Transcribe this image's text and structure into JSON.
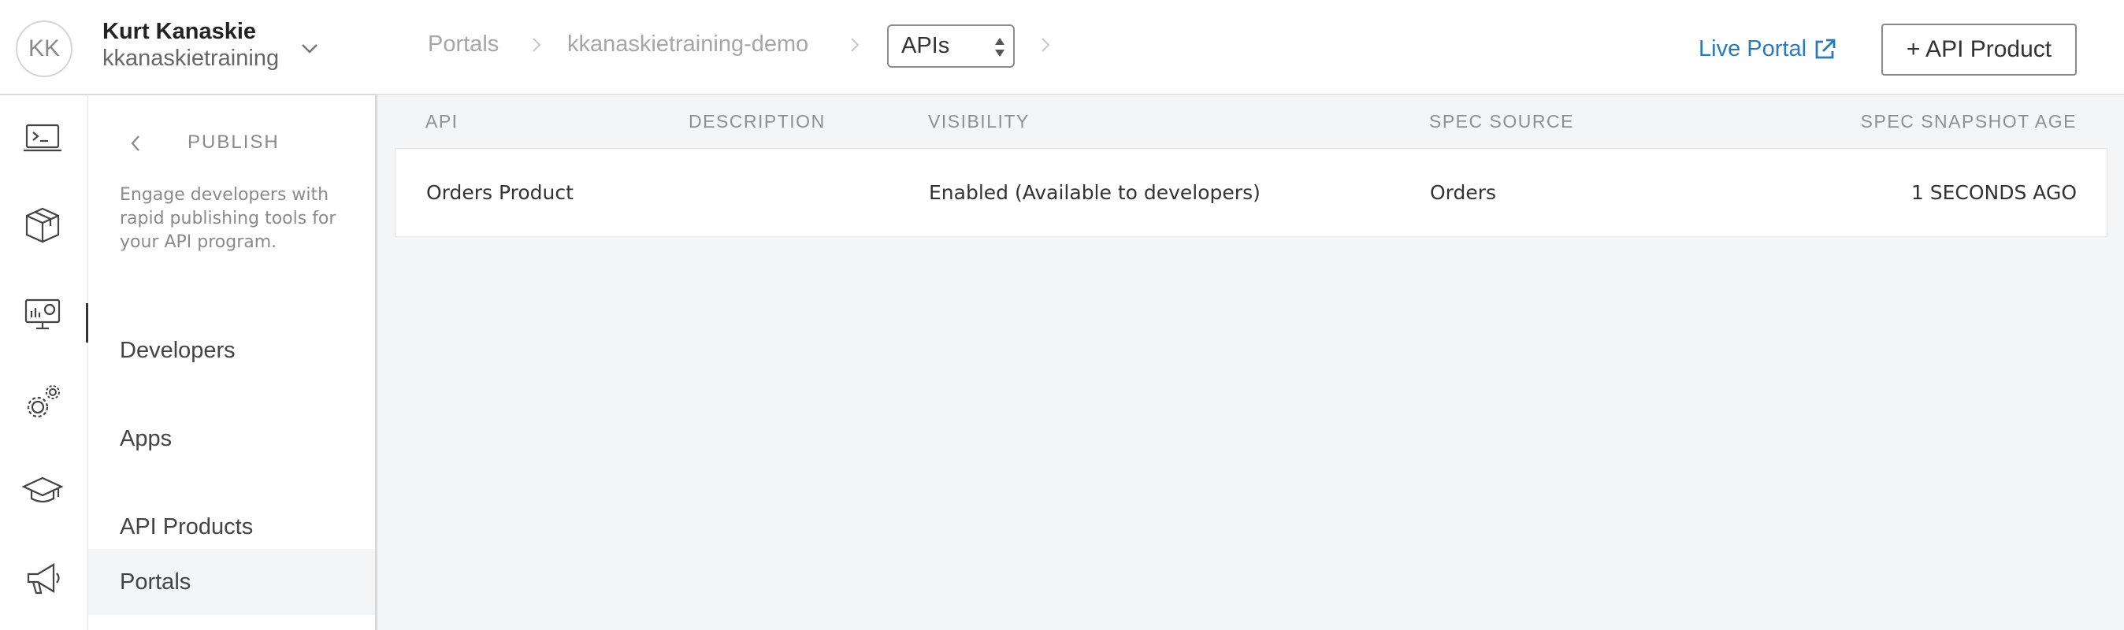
{
  "user": {
    "initials": "KK",
    "name": "Kurt Kanaskie",
    "org": "kkanaskietraining"
  },
  "breadcrumb": {
    "items": [
      "Portals",
      "kkanaskietraining-demo"
    ],
    "select_value": "APIs"
  },
  "header_actions": {
    "live_portal": "Live Portal",
    "add_button": "+ API Product"
  },
  "rail": {
    "icons": [
      "develop-icon",
      "publish-icon",
      "analyze-icon",
      "admin-icon",
      "learn-icon",
      "announcements-icon"
    ],
    "active": "publish-icon"
  },
  "subnav": {
    "title": "PUBLISH",
    "description": "Engage developers with rapid publishing tools for your API program.",
    "items": [
      "Developers",
      "Apps",
      "API Products",
      "Portals"
    ],
    "active": "Portals"
  },
  "table": {
    "headers": [
      "API",
      "DESCRIPTION",
      "VISIBILITY",
      "SPEC SOURCE",
      "SPEC SNAPSHOT AGE"
    ],
    "rows": [
      {
        "api": "Orders Product",
        "description": "",
        "visibility": "Enabled (Available to developers)",
        "spec_source": "Orders",
        "snapshot_age": "1 SECONDS AGO"
      }
    ]
  },
  "colors": {
    "link": "#2a7ab8",
    "background": "#f4f5f6",
    "muted_text": "#8f8f8f"
  }
}
